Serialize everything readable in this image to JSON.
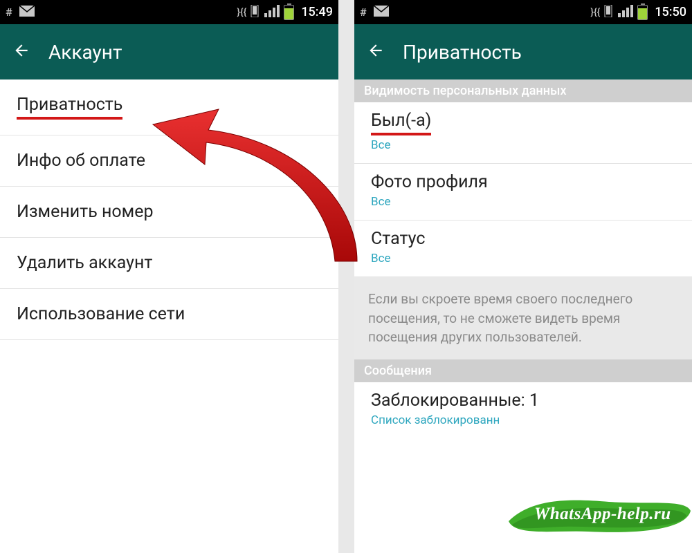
{
  "status_icons": {
    "hash": "#",
    "vibrate": "}{{",
    "data": "⇅"
  },
  "left": {
    "time": "15:49",
    "title": "Аккаунт",
    "items": [
      "Приватность",
      "Инфо об оплате",
      "Изменить номер",
      "Удалить аккаунт",
      "Использование сети"
    ]
  },
  "right": {
    "time": "15:50",
    "title": "Приватность",
    "section1": "Видимость персональных данных",
    "rows": [
      {
        "label": "Был(-а)",
        "value": "Все"
      },
      {
        "label": "Фото профиля",
        "value": "Все"
      },
      {
        "label": "Статус",
        "value": "Все"
      }
    ],
    "info": "Если вы скроете время своего последнего посещения, то не сможете видеть время посещения других пользователей.",
    "section2": "Сообщения",
    "blocked_label": "Заблокированные: 1",
    "blocked_sub": "Список заблокированн"
  },
  "watermark": "WhatsApp-help.ru"
}
